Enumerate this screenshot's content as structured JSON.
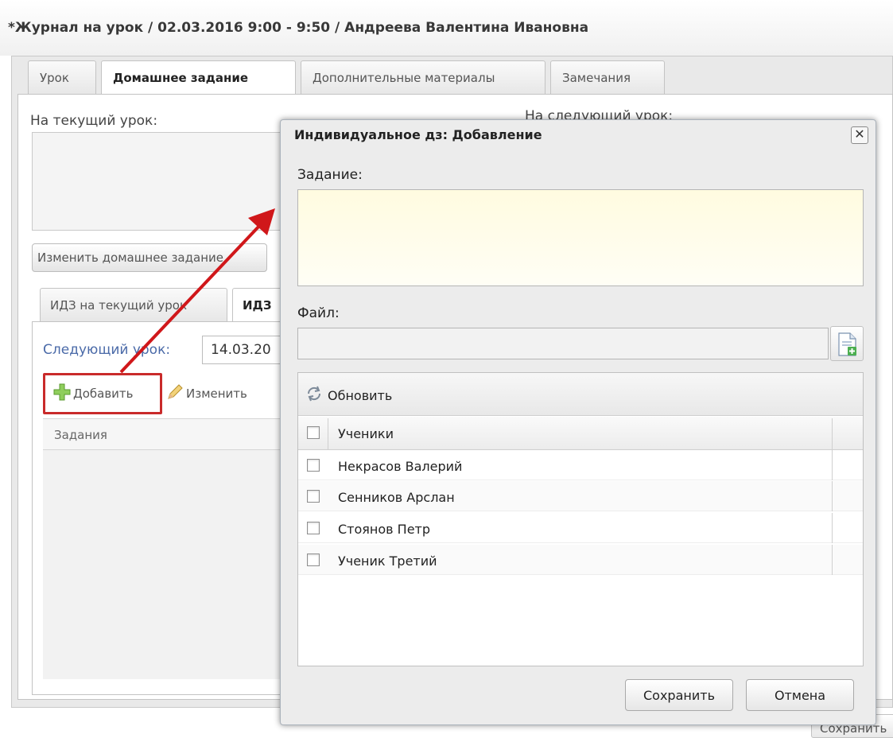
{
  "window": {
    "title": "*Журнал на урок / 02.03.2016 9:00 - 9:50 / Андреева Валентина Ивановна",
    "tabs": [
      "Урок",
      "Домашнее задание",
      "Дополнительные материалы",
      "Замечания"
    ],
    "active_tab": "Домашнее задание",
    "current_lesson_label": "На текущий урок:",
    "next_lesson_label": "На следующий урок:",
    "edit_homework_button": "Изменить домашнее задание",
    "subtabs": [
      "ИДЗ на текущий урок",
      "ИДЗ"
    ],
    "next_lesson_date_label": "Следующий урок:",
    "next_lesson_date_value": "14.03.20",
    "toolbar": {
      "add": "Добавить",
      "edit": "Изменить"
    },
    "grid_header": "Задания",
    "bottom_save": "Сохранить"
  },
  "modal": {
    "title": "Индивидуальное дз: Добавление",
    "task_label": "Задание:",
    "task_value": "",
    "file_label": "Файл:",
    "file_value": "",
    "refresh_button": "Обновить",
    "students_header": "Ученики",
    "students": [
      "Некрасов Валерий",
      "Сенников Арслан",
      "Стоянов Петр",
      "Ученик Третий"
    ],
    "save_button": "Сохранить",
    "cancel_button": "Отмена"
  },
  "colors": {
    "highlight": "#c92a2a",
    "arrow": "#d0171a",
    "link_label": "#4a6aa8",
    "task_field_bg": "#fffbe0"
  },
  "icons": [
    "plus-icon",
    "pencil-icon",
    "refresh-icon",
    "file-add-icon",
    "close-icon"
  ]
}
